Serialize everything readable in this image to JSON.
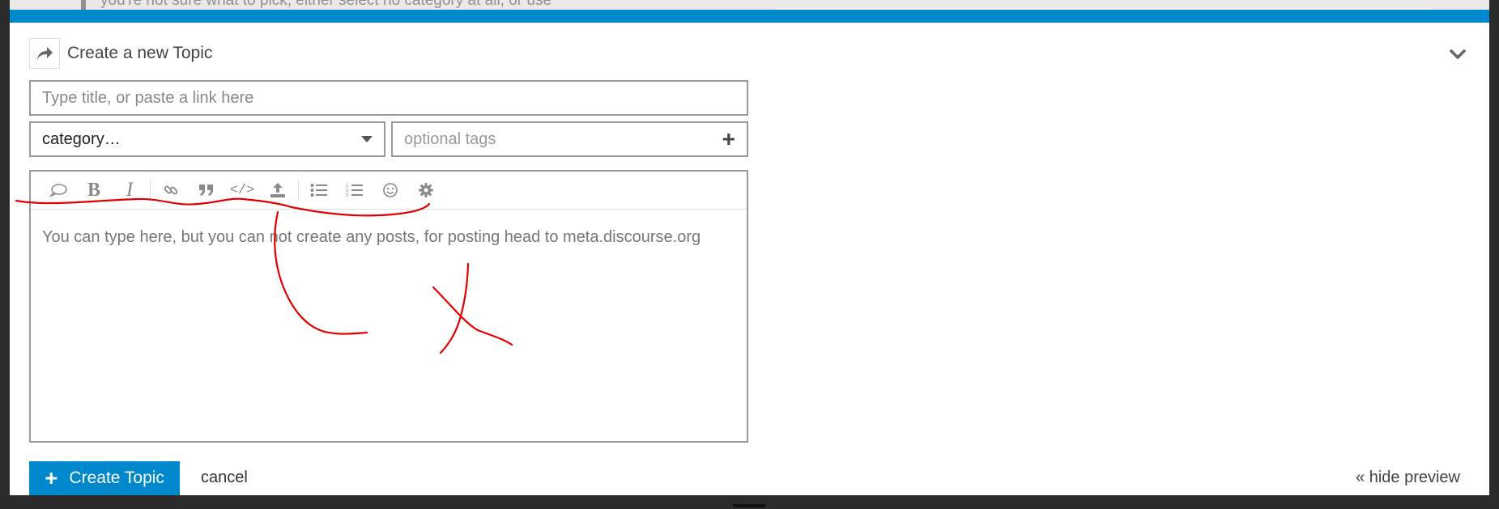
{
  "backdrop": {
    "partial_text": "you're not sure what to pick, either select no category at all, or use"
  },
  "composer": {
    "header": {
      "icon": "reply-icon",
      "title": "Create a new Topic",
      "toggle_icon": "chevron-down-icon"
    },
    "title_input": {
      "placeholder": "Type title, or paste a link here",
      "value": ""
    },
    "category": {
      "label": "category…",
      "icon": "caret-down-icon"
    },
    "tags": {
      "placeholder": "optional tags",
      "add_icon": "plus-icon"
    },
    "toolbar": {
      "buttons": [
        {
          "name": "blockquote-icon",
          "glyph": "speech-bubble"
        },
        {
          "name": "bold-icon",
          "glyph": "B"
        },
        {
          "name": "italic-icon",
          "glyph": "I"
        },
        {
          "name": "link-icon",
          "glyph": "link"
        },
        {
          "name": "quote-icon",
          "glyph": "quote"
        },
        {
          "name": "code-icon",
          "glyph": "</>"
        },
        {
          "name": "upload-icon",
          "glyph": "upload"
        },
        {
          "name": "bullet-list-icon",
          "glyph": "list"
        },
        {
          "name": "numbered-list-icon",
          "glyph": "ordered-list"
        },
        {
          "name": "emoji-icon",
          "glyph": "smile"
        },
        {
          "name": "gear-icon",
          "glyph": "gear"
        }
      ]
    },
    "editor_text": "You can type here, but you can not create any posts, for posting head to meta.discourse.org",
    "create_button": {
      "label": "Create Topic",
      "icon": "plus-icon",
      "color": "#0088cc"
    },
    "cancel_label": "cancel",
    "hide_preview_label": "« hide preview"
  },
  "colors": {
    "accent": "#0088cc",
    "annotation": "#e00000"
  }
}
